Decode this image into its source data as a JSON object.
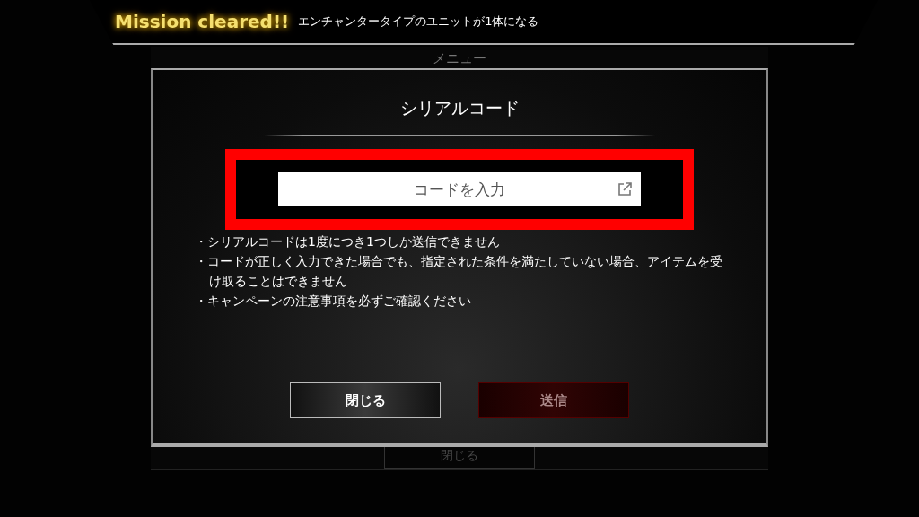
{
  "background_menu": {
    "title": "メニュー",
    "close_button": "閉じる"
  },
  "mission_banner": {
    "badge": "Mission cleared!!",
    "message": "エンチャンタータイプのユニットが1体になる"
  },
  "dialog": {
    "title": "シリアルコード",
    "code_field": {
      "placeholder": "コードを入力",
      "highlighted": true
    },
    "notes": [
      "・シリアルコードは1度につき1つしか送信できません",
      "・コードが正しく入力できた場合でも、指定された条件を満たしていない場合、アイテムを受け取ることはできません",
      "・キャンペーンの注意事項を必ずご確認ください"
    ],
    "buttons": [
      {
        "label": "閉じる",
        "kind": "close",
        "disabled": false
      },
      {
        "label": "送信",
        "kind": "submit",
        "disabled": true
      }
    ]
  }
}
